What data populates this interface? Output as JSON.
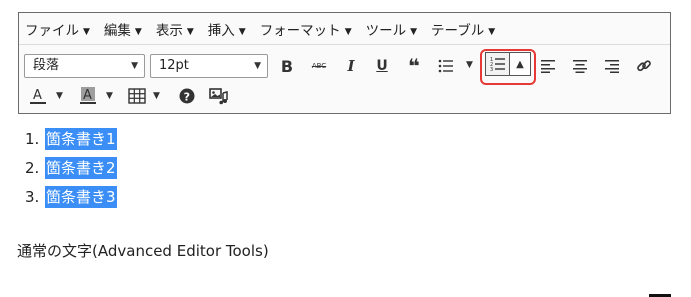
{
  "menu": [
    {
      "label": "ファイル"
    },
    {
      "label": "編集"
    },
    {
      "label": "表示"
    },
    {
      "label": "挿入"
    },
    {
      "label": "フォーマット"
    },
    {
      "label": "ツール"
    },
    {
      "label": "テーブル"
    }
  ],
  "toolbar": {
    "block_format": "段落",
    "font_size": "12pt"
  },
  "content": {
    "list": [
      {
        "number": "1.",
        "text": "箇条書き1"
      },
      {
        "number": "2.",
        "text": "箇条書き2"
      },
      {
        "number": "3.",
        "text": "箇条書き3"
      }
    ],
    "paragraph": "通常の文字(Advanced Editor Tools)"
  },
  "colors": {
    "selection": "#3a8ef5",
    "highlight_border": "#e53935"
  }
}
